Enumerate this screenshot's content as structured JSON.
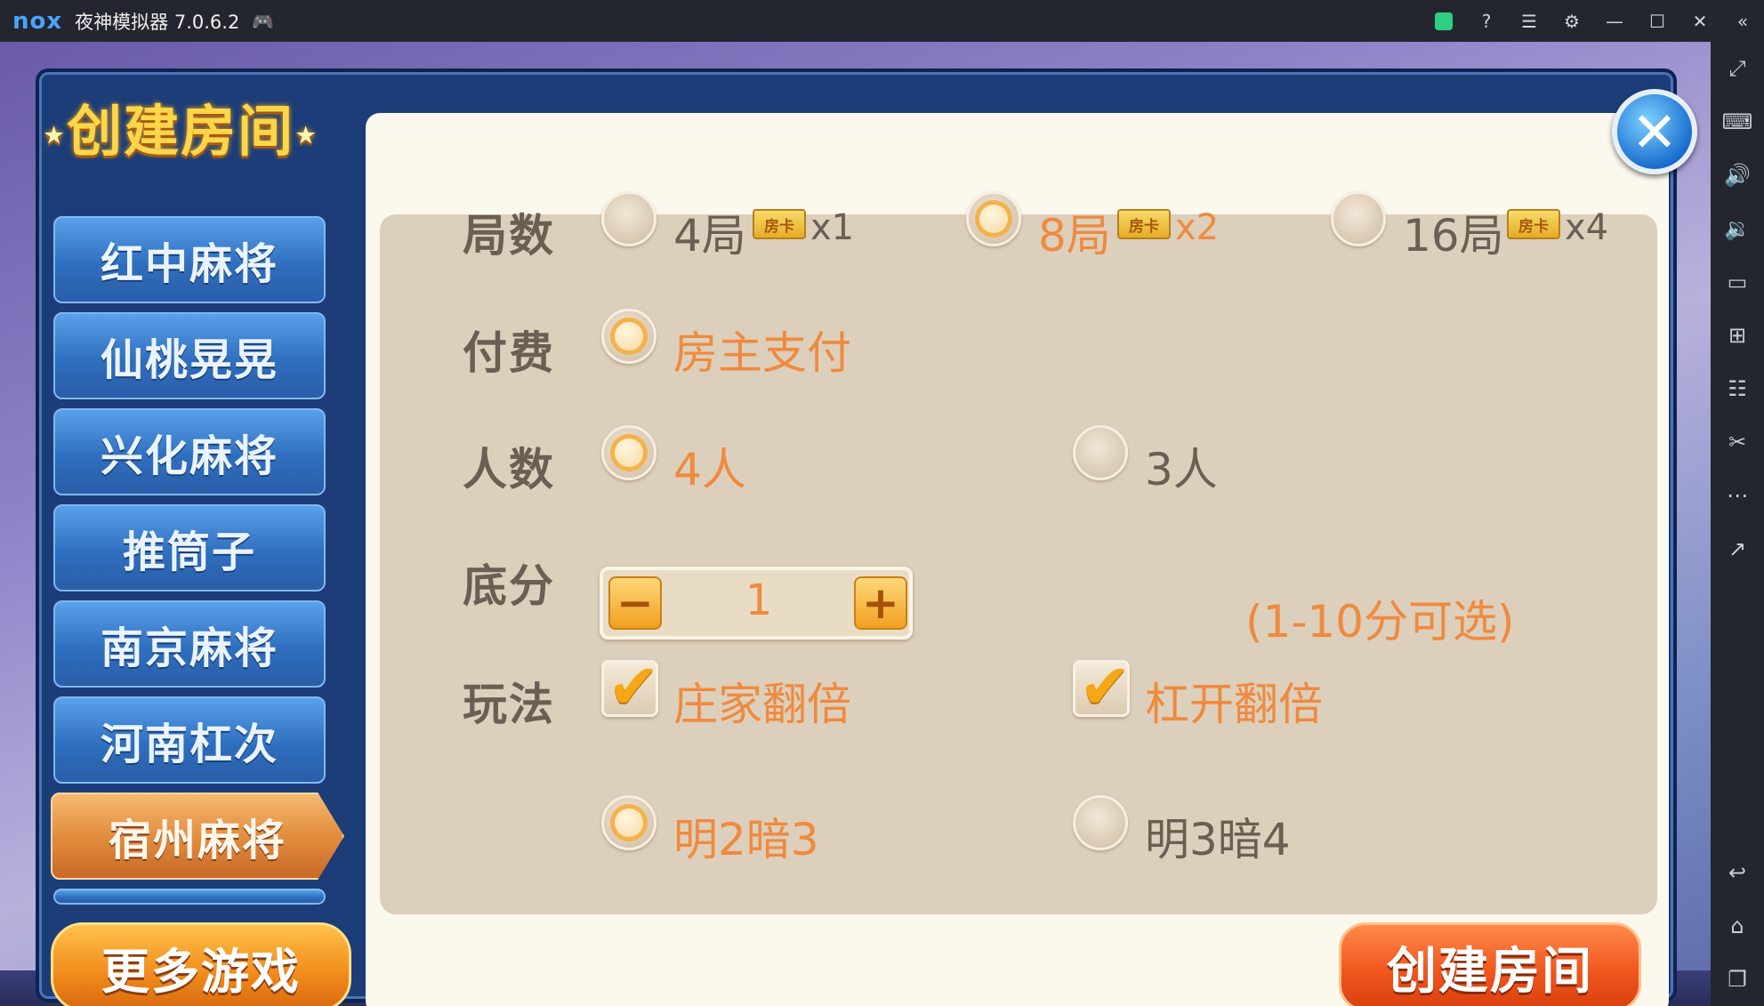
{
  "window": {
    "app_title": "夜神模拟器 7.0.6.2",
    "logo_text": "nox"
  },
  "dialog": {
    "title": "创建房间",
    "close_icon": "close-icon"
  },
  "games": [
    {
      "label": "红中麻将",
      "active": false
    },
    {
      "label": "仙桃晃晃",
      "active": false
    },
    {
      "label": "兴化麻将",
      "active": false
    },
    {
      "label": "推筒子",
      "active": false
    },
    {
      "label": "南京麻将",
      "active": false
    },
    {
      "label": "河南杠次",
      "active": false
    },
    {
      "label": "宿州麻将",
      "active": true
    }
  ],
  "more_games_label": "更多游戏",
  "create_room_label": "创建房间",
  "settings": {
    "rounds": {
      "label": "局数",
      "options": [
        {
          "text": "4局",
          "badge": "房卡",
          "mult": "x1",
          "selected": false
        },
        {
          "text": "8局",
          "badge": "房卡",
          "mult": "x2",
          "selected": true
        },
        {
          "text": "16局",
          "badge": "房卡",
          "mult": "x4",
          "selected": false
        }
      ]
    },
    "payment": {
      "label": "付费",
      "options": [
        {
          "text": "房主支付",
          "selected": true
        }
      ]
    },
    "players": {
      "label": "人数",
      "options": [
        {
          "text": "4人",
          "selected": true
        },
        {
          "text": "3人",
          "selected": false
        }
      ]
    },
    "base_score": {
      "label": "底分",
      "minus": "−",
      "value": "1",
      "plus": "+",
      "hint": "(1-10分可选)"
    },
    "play_rules": {
      "label": "玩法",
      "checks": [
        {
          "text": "庄家翻倍",
          "checked": true
        },
        {
          "text": "杠开翻倍",
          "checked": true
        }
      ],
      "options": [
        {
          "text": "明2暗3",
          "selected": true
        },
        {
          "text": "明3暗4",
          "selected": false
        }
      ]
    }
  },
  "colors": {
    "accent": "#ef8a3e",
    "label": "#6b5e52",
    "panel": "#dccfbb",
    "tab_blue": "#2f6fbf",
    "tab_active": "#e08a3a"
  }
}
